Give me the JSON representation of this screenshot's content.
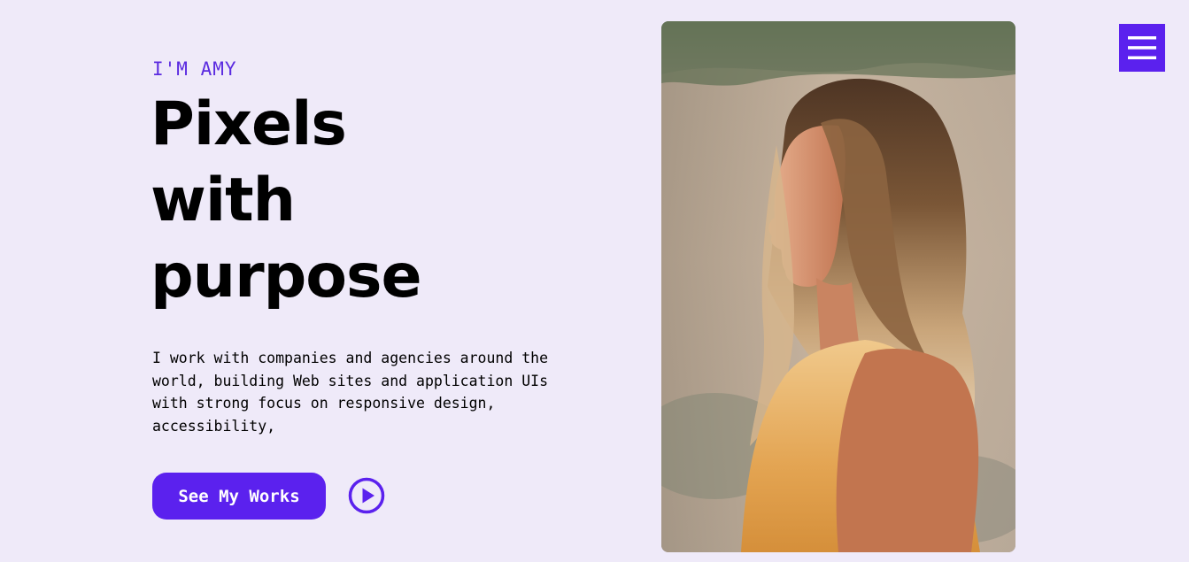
{
  "hero": {
    "eyebrow": "I'M AMY",
    "headline": [
      "Pixels",
      "with",
      "purpose"
    ],
    "intro": "I work with companies and agencies around the world, building Web sites and application UIs with strong focus on responsive design, accessibility,",
    "cta_label": "See My Works"
  },
  "icons": {
    "play": "play-circle-icon",
    "menu": "hamburger-menu-icon"
  },
  "colors": {
    "accent": "#5b21ee",
    "eyebrow": "#5b2be0",
    "background": "#efeaf9",
    "text": "#000000"
  }
}
